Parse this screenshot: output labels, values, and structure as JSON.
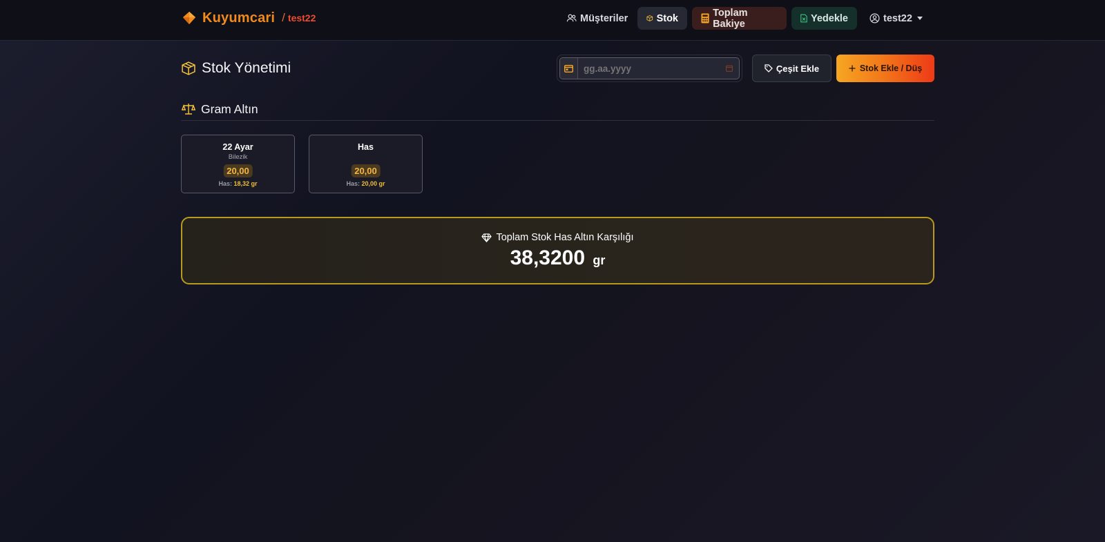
{
  "brand": {
    "name": "Kuyumcari",
    "separator": "/",
    "user": "test22"
  },
  "nav": {
    "customers": "Müşteriler",
    "stock": "Stok",
    "balance": "Toplam Bakiye",
    "backup": "Yedekle",
    "user": "test22"
  },
  "page": {
    "title": "Stok Yönetimi",
    "date_placeholder": "gg.aa.yyyy",
    "add_variety": "Çeşit Ekle",
    "add_stock": "Stok Ekle / Düş"
  },
  "section": {
    "title": "Gram Altın"
  },
  "cards": [
    {
      "name": "22 Ayar",
      "sub": "Bilezik",
      "qty": "20,00",
      "has_label": "Has:",
      "has_value": "18,32 gr"
    },
    {
      "name": "Has",
      "sub": "",
      "qty": "20,00",
      "has_label": "Has:",
      "has_value": "20,00 gr"
    }
  ],
  "total": {
    "label": "Toplam Stok Has Altın Karşılığı",
    "value": "38,3200",
    "unit": "gr"
  },
  "colors": {
    "brand_orange": "#f28a1c",
    "accent_gold": "#f5b544",
    "total_border": "#b89a20",
    "gradient_start": "#f6a623",
    "gradient_end": "#ee3a17"
  }
}
